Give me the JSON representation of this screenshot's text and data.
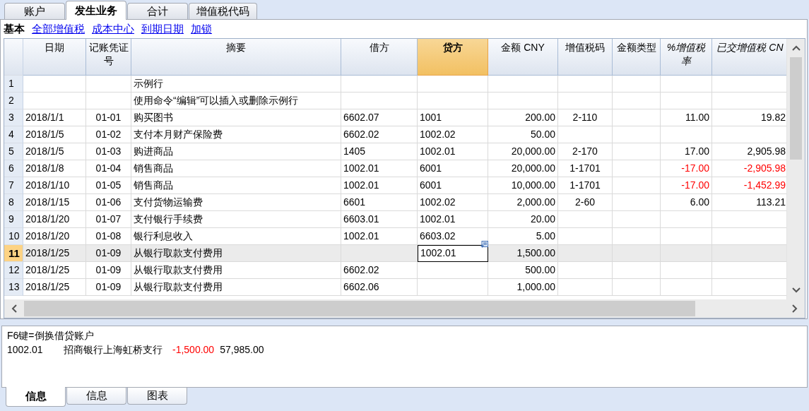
{
  "tabs": [
    {
      "label": "账户",
      "selected": false
    },
    {
      "label": "发生业务",
      "selected": true
    },
    {
      "label": "合计",
      "selected": false
    },
    {
      "label": "增值税代码",
      "selected": false
    }
  ],
  "views": [
    {
      "label": "基本",
      "selected": true
    },
    {
      "label": "全部增值税",
      "selected": false
    },
    {
      "label": "成本中心",
      "selected": false
    },
    {
      "label": "到期日期",
      "selected": false
    },
    {
      "label": "加锁",
      "selected": false
    }
  ],
  "table": {
    "columns": [
      {
        "label": "日期",
        "selected": false
      },
      {
        "label": "记账凭证号",
        "selected": false
      },
      {
        "label": "摘要",
        "selected": false
      },
      {
        "label": "借方",
        "selected": false
      },
      {
        "label": "贷方",
        "selected": true
      },
      {
        "label": "金额 CNY",
        "selected": false
      },
      {
        "label": "增值税码",
        "selected": false
      },
      {
        "label": "金额类型",
        "selected": false
      },
      {
        "label": "%增值税率",
        "selected": false
      },
      {
        "label": "已交增值税 CN",
        "selected": false
      }
    ],
    "rows": [
      {
        "number": "1",
        "selected": false,
        "editing": false,
        "cells": [
          "",
          "",
          "示例行",
          "",
          "",
          "",
          "",
          "",
          "",
          ""
        ]
      },
      {
        "number": "2",
        "selected": false,
        "editing": false,
        "cells": [
          "",
          "",
          "使用命令“编辑”可以插入或删除示例行",
          "",
          "",
          "",
          "",
          "",
          "",
          ""
        ]
      },
      {
        "number": "3",
        "selected": false,
        "editing": false,
        "cells": [
          "2018/1/1",
          "01-01",
          "购买图书",
          "6602.07",
          "1001",
          "200.00",
          "2-110",
          "",
          "11.00",
          "19.82"
        ]
      },
      {
        "number": "4",
        "selected": false,
        "editing": false,
        "cells": [
          "2018/1/5",
          "01-02",
          "支付本月财产保险费",
          "6602.02",
          "1002.02",
          "50.00",
          "",
          "",
          "",
          ""
        ]
      },
      {
        "number": "5",
        "selected": false,
        "editing": false,
        "cells": [
          "2018/1/5",
          "01-03",
          "购进商品",
          "1405",
          "1002.01",
          "20,000.00",
          "2-170",
          "",
          "17.00",
          "2,905.98"
        ]
      },
      {
        "number": "6",
        "selected": false,
        "editing": false,
        "cells": [
          "2018/1/8",
          "01-04",
          "销售商品",
          "1002.01",
          "6001",
          "20,000.00",
          "1-1701",
          "",
          {
            "text": "-17.00",
            "color": "#ff0000"
          },
          {
            "text": "-2,905.98",
            "color": "#ff0000"
          }
        ]
      },
      {
        "number": "7",
        "selected": false,
        "editing": false,
        "cells": [
          "2018/1/10",
          "01-05",
          "销售商品",
          "1002.01",
          "6001",
          "10,000.00",
          "1-1701",
          "",
          {
            "text": "-17.00",
            "color": "#ff0000"
          },
          {
            "text": "-1,452.99",
            "color": "#ff0000"
          }
        ]
      },
      {
        "number": "8",
        "selected": false,
        "editing": false,
        "cells": [
          "2018/1/15",
          "01-06",
          "支付货物运输费",
          "6601",
          "1002.02",
          "2,000.00",
          "2-60",
          "",
          "6.00",
          "113.21"
        ]
      },
      {
        "number": "9",
        "selected": false,
        "editing": false,
        "cells": [
          "2018/1/20",
          "01-07",
          "支付银行手续费",
          "6603.01",
          "1002.01",
          "20.00",
          "",
          "",
          "",
          ""
        ]
      },
      {
        "number": "10",
        "selected": false,
        "editing": false,
        "cells": [
          "2018/1/20",
          "01-08",
          "银行利息收入",
          "1002.01",
          "6603.02",
          "5.00",
          "",
          "",
          "",
          ""
        ]
      },
      {
        "number": "11",
        "selected": true,
        "editing": true,
        "cells": [
          "2018/1/25",
          "01-09",
          "从银行取款支付费用",
          "",
          "1002.01",
          "1,500.00",
          "",
          "",
          "",
          ""
        ]
      },
      {
        "number": "12",
        "selected": false,
        "editing": false,
        "cells": [
          "2018/1/25",
          "01-09",
          "从银行取款支付费用",
          "6602.02",
          "",
          "500.00",
          "",
          "",
          "",
          ""
        ]
      },
      {
        "number": "13",
        "selected": false,
        "editing": false,
        "cells": [
          "2018/1/25",
          "01-09",
          "从银行取款支付费用",
          "6602.06",
          "",
          "1,000.00",
          "",
          "",
          "",
          ""
        ]
      }
    ]
  },
  "info": {
    "hint": "F6键=倒换借贷账户",
    "account": "1002.01",
    "account_name": "招商银行上海虹桥支行",
    "amount": "-1,500.00",
    "amount_negative": true,
    "balance": "57,985.00"
  },
  "bottom_tabs": [
    {
      "label": "信息",
      "selected": true
    },
    {
      "label": "信息",
      "selected": false
    },
    {
      "label": "图表",
      "selected": false
    }
  ]
}
